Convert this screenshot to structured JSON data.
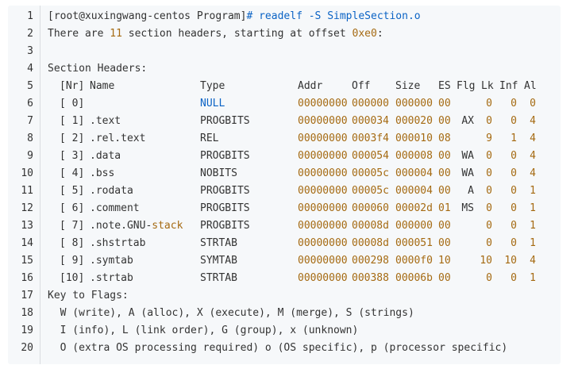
{
  "code_block": {
    "line_numbers": [
      "1",
      "2",
      "3",
      "4",
      "5",
      "6",
      "7",
      "8",
      "9",
      "10",
      "11",
      "12",
      "13",
      "14",
      "15",
      "16",
      "17",
      "18",
      "19",
      "20"
    ],
    "prompt": {
      "user_host": "[root@xuxingwang-centos Program]",
      "command": "# readelf -S SimpleSection.o"
    },
    "summary": {
      "prefix": "There are ",
      "count": "11",
      "middle": " section headers, starting at offset ",
      "offset": "0xe0",
      "suffix": ":"
    },
    "section_title": "Section Headers:",
    "columns": {
      "nr": "[Nr]",
      "name": "Name",
      "type": "Type",
      "addr": "Addr",
      "off": "Off",
      "size": "Size",
      "es": "ES",
      "flg": "Flg",
      "lk": "Lk",
      "inf": "Inf",
      "al": "Al"
    },
    "rows": [
      {
        "nr": "[ 0]",
        "name": "",
        "name_hl": "",
        "type": "NULL",
        "type_kw": true,
        "addr": "00000000",
        "off": "000000",
        "size": "000000",
        "es": "00",
        "flg": "",
        "lk": "0",
        "inf": "0",
        "al": "0"
      },
      {
        "nr": "[ 1]",
        "name": ".text",
        "name_hl": "",
        "type": "PROGBITS",
        "type_kw": false,
        "addr": "00000000",
        "off": "000034",
        "size": "000020",
        "es": "00",
        "flg": "AX",
        "lk": "0",
        "inf": "0",
        "al": "4"
      },
      {
        "nr": "[ 2]",
        "name": ".rel.text",
        "name_hl": "",
        "type": "REL",
        "type_kw": false,
        "addr": "00000000",
        "off": "0003f4",
        "size": "000010",
        "es": "08",
        "flg": "",
        "lk": "9",
        "inf": "1",
        "al": "4"
      },
      {
        "nr": "[ 3]",
        "name": ".data",
        "name_hl": "",
        "type": "PROGBITS",
        "type_kw": false,
        "addr": "00000000",
        "off": "000054",
        "size": "000008",
        "es": "00",
        "flg": "WA",
        "lk": "0",
        "inf": "0",
        "al": "4"
      },
      {
        "nr": "[ 4]",
        "name": ".bss",
        "name_hl": "",
        "type": "NOBITS",
        "type_kw": false,
        "addr": "00000000",
        "off": "00005c",
        "size": "000004",
        "es": "00",
        "flg": "WA",
        "lk": "0",
        "inf": "0",
        "al": "4"
      },
      {
        "nr": "[ 5]",
        "name": ".rodata",
        "name_hl": "",
        "type": "PROGBITS",
        "type_kw": false,
        "addr": "00000000",
        "off": "00005c",
        "size": "000004",
        "es": "00",
        "flg": "A",
        "lk": "0",
        "inf": "0",
        "al": "1"
      },
      {
        "nr": "[ 6]",
        "name": ".comment",
        "name_hl": "",
        "type": "PROGBITS",
        "type_kw": false,
        "addr": "00000000",
        "off": "000060",
        "size": "00002d",
        "es": "01",
        "flg": "MS",
        "lk": "0",
        "inf": "0",
        "al": "1"
      },
      {
        "nr": "[ 7]",
        "name": ".note.GNU-",
        "name_hl": "stack",
        "type": "PROGBITS",
        "type_kw": false,
        "addr": "00000000",
        "off": "00008d",
        "size": "000000",
        "es": "00",
        "flg": "",
        "lk": "0",
        "inf": "0",
        "al": "1"
      },
      {
        "nr": "[ 8]",
        "name": ".shstrtab",
        "name_hl": "",
        "type": "STRTAB",
        "type_kw": false,
        "addr": "00000000",
        "off": "00008d",
        "size": "000051",
        "es": "00",
        "flg": "",
        "lk": "0",
        "inf": "0",
        "al": "1"
      },
      {
        "nr": "[ 9]",
        "name": ".symtab",
        "name_hl": "",
        "type": "SYMTAB",
        "type_kw": false,
        "addr": "00000000",
        "off": "000298",
        "size": "0000f0",
        "es": "10",
        "flg": "",
        "lk": "10",
        "inf": "10",
        "al": "4"
      },
      {
        "nr": "[10]",
        "name": ".strtab",
        "name_hl": "",
        "type": "STRTAB",
        "type_kw": false,
        "addr": "00000000",
        "off": "000388",
        "size": "00006b",
        "es": "00",
        "flg": "",
        "lk": "0",
        "inf": "0",
        "al": "1"
      }
    ],
    "key_title": "Key to Flags:",
    "key_lines": [
      "  W (write), A (alloc), X (execute), M (merge), S (strings)",
      "  I (info), L (link order), G (group), x (unknown)",
      "  O (extra OS processing required) o (OS specific), p (processor specific)"
    ],
    "colors": {
      "background": "#f6f8fa",
      "text": "#333333",
      "keyword": "#0b63c5",
      "number": "#a56a12"
    }
  }
}
